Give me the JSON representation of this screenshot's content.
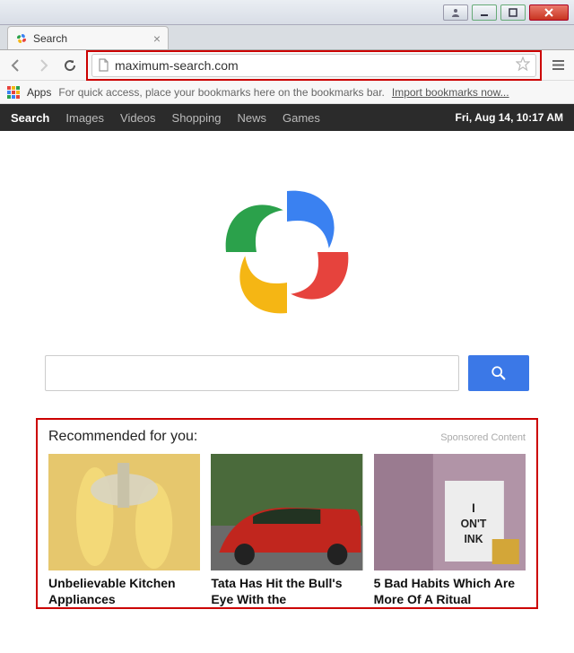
{
  "window": {
    "user_btn": "user",
    "min_btn": "minimize",
    "max_btn": "maximize",
    "close_btn": "close"
  },
  "tab": {
    "title": "Search",
    "close": "×"
  },
  "toolbar": {
    "back": "back",
    "forward": "forward",
    "reload": "reload",
    "url": "maximum-search.com",
    "menu": "menu"
  },
  "bookmarks": {
    "apps_label": "Apps",
    "hint": "For quick access, place your bookmarks here on the bookmarks bar.",
    "import_link": "Import bookmarks now..."
  },
  "pagenav": {
    "items": [
      {
        "label": "Search",
        "active": true
      },
      {
        "label": "Images",
        "active": false
      },
      {
        "label": "Videos",
        "active": false
      },
      {
        "label": "Shopping",
        "active": false
      },
      {
        "label": "News",
        "active": false
      },
      {
        "label": "Games",
        "active": false
      }
    ],
    "clock": "Fri, Aug 14, 10:17 AM"
  },
  "search": {
    "value": "",
    "placeholder": "",
    "button": "search"
  },
  "sponsored": {
    "title": "Recommended for you:",
    "label": "Sponsored Content",
    "cards": [
      {
        "title": "Unbelievable Kitchen Appliances"
      },
      {
        "title": "Tata Has Hit the Bull's Eye With the"
      },
      {
        "title": "5 Bad Habits Which Are More Of A Ritual"
      }
    ]
  }
}
